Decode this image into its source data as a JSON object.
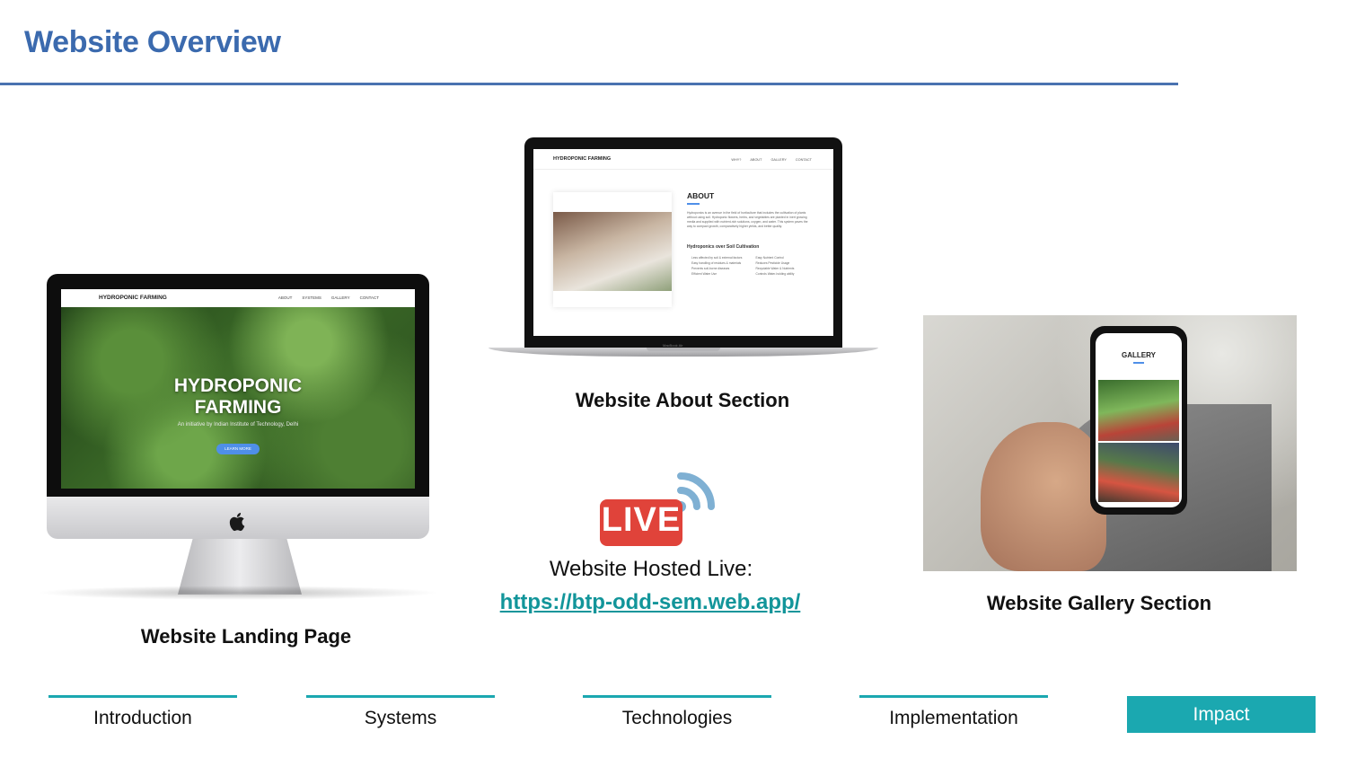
{
  "header": {
    "title": "Website Overview"
  },
  "landing_mockup": {
    "brand": "HYDROPONIC FARMING",
    "nav_links": [
      "ABOUT",
      "SYSTEMS",
      "GALLERY",
      "CONTACT"
    ],
    "hero_title_line1": "HYDROPONIC",
    "hero_title_line2": "FARMING",
    "hero_subtitle": "An initiative by Indian Institute of Technology, Delhi",
    "cta": "LEARN MORE"
  },
  "about_mockup": {
    "brand": "HYDROPONIC FARMING",
    "nav_links": [
      "WHY?",
      "ABOUT",
      "GALLERY",
      "CONTACT"
    ],
    "heading": "ABOUT",
    "paragraph": "Hydroponics is an avenue in the field of horticulture that includes the cultivation of plants without using soil. Hydroponic flowers, herbs, and vegetables are planted in inert growing media and supplied with nutrient-rich solutions, oxygen, and water. This system paves the way to compact growth, comparatively higher yields, and better quality.",
    "subheading": "Hydroponics over Soil Cultivation",
    "bullets": [
      "Less affected by soil & external factors",
      "Easy handling of residues & materials",
      "Prevents soil-borne diseases",
      "Efficient Water Use",
      "Easy Nutrient Control",
      "Reduces Pesticide Usage",
      "Recyclable Water & Nutrients",
      "Controls Water-holding ability"
    ],
    "device_label": "MacBook Air"
  },
  "gallery_mockup": {
    "title": "GALLERY"
  },
  "captions": {
    "about": "Website About Section",
    "landing": "Website Landing Page",
    "gallery": "Website Gallery Section"
  },
  "live": {
    "badge": "LIVE",
    "label": "Website Hosted Live:",
    "url": "https://btp-odd-sem.web.app/"
  },
  "nav": [
    {
      "label": "Introduction",
      "active": false
    },
    {
      "label": "Systems",
      "active": false
    },
    {
      "label": "Technologies",
      "active": false
    },
    {
      "label": "Implementation",
      "active": false
    },
    {
      "label": "Impact",
      "active": true
    }
  ],
  "colors": {
    "title": "#3b6aae",
    "accent": "#1ba8b0",
    "link": "#12959a",
    "live_red": "#e0433a",
    "live_wave": "#7fb0d3"
  }
}
